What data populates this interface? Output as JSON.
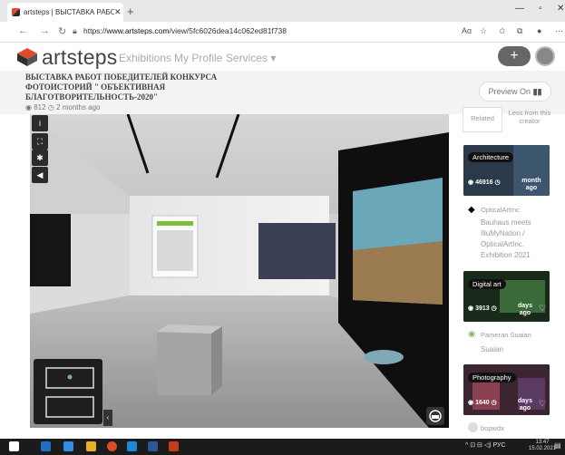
{
  "browser": {
    "tab_title": "artsteps | ВЫСТАВКА РАБОТ ПО",
    "tab_close": "✕",
    "new_tab": "+",
    "url_prefix": "https://",
    "url_host": "www.artsteps.com",
    "url_path": "/view/5fc6026dea14c062ed81f738",
    "reader_label": "Aɑ"
  },
  "site": {
    "brand": "artsteps",
    "nav": [
      "Exhibitions",
      "My Profile",
      "Services ▾"
    ],
    "plus": "+"
  },
  "exhibition": {
    "title": "ВЫСТАВКА РАБОТ ПОБЕДИТЕЛЕЙ КОНКУРСА ФОТОИСТОРИЙ \" ОБЪЕКТИВНАЯ БЛАГОТВОРИТЕЛЬНОСТЬ-2020\"",
    "views": "812",
    "age": "2 months ago",
    "preview_label": "Preview On"
  },
  "sidebar": {
    "tabs": [
      "Related",
      "Less from this creator"
    ],
    "cards": [
      {
        "tag": "Architecture",
        "views": "46916",
        "ago": "month ago",
        "author": "OpticalArtInc",
        "name": "Bauhaus meets IlluMyNation / OpticalArtInc. Exhibition 2021"
      },
      {
        "tag": "Digital art",
        "views": "3913",
        "ago": "days ago",
        "author": "Pameran Suaian",
        "name": "Suaian"
      },
      {
        "tag": "Photography",
        "views": "1640",
        "ago": "days ago",
        "author": "bopwdx",
        "name": ""
      }
    ]
  },
  "taskbar": {
    "tray": "^ ⊡ ⊟ ◁) РУС",
    "time": "13:47",
    "date": "15.02.2021"
  },
  "colors": {
    "accent": "#e24a2b",
    "dark": "#2b2b2b"
  }
}
